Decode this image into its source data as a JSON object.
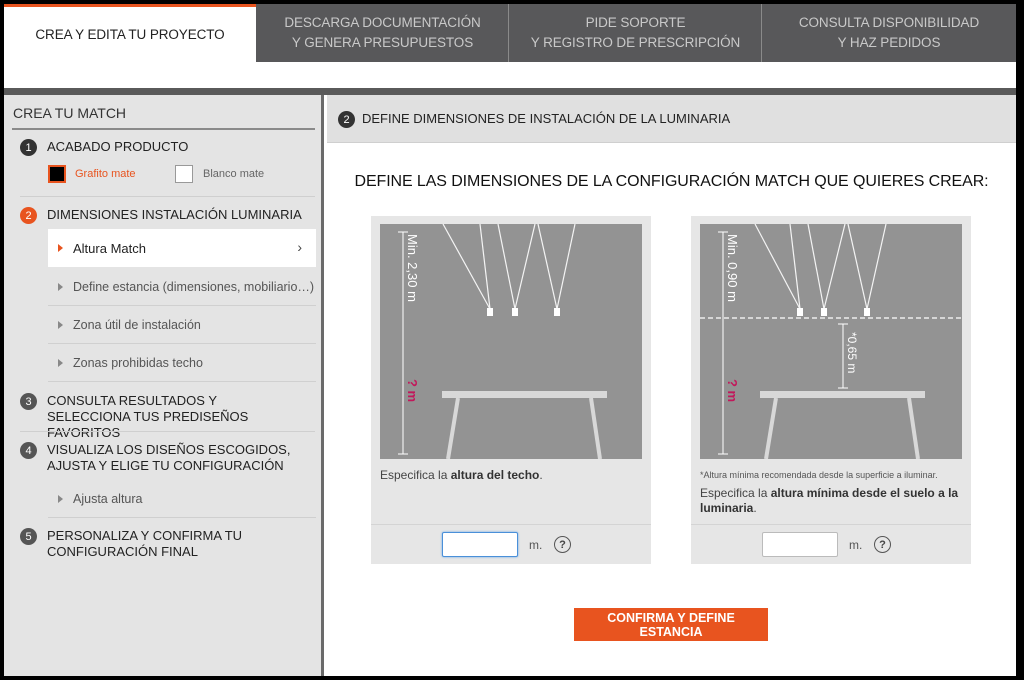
{
  "tabs": [
    {
      "line1": "CREA Y EDITA TU PROYECTO",
      "line2": ""
    },
    {
      "line1": "DESCARGA DOCUMENTACIÓN",
      "line2": "Y GENERA PRESUPUESTOS"
    },
    {
      "line1": "PIDE SOPORTE",
      "line2": "Y REGISTRO DE PRESCRIPCIÓN"
    },
    {
      "line1": "CONSULTA DISPONIBILIDAD",
      "line2": "Y HAZ PEDIDOS"
    }
  ],
  "sidebar": {
    "title": "CREA TU MATCH",
    "steps": [
      {
        "num": "1",
        "label": "ACABADO PRODUCTO"
      },
      {
        "num": "2",
        "label": "DIMENSIONES INSTALACIÓN LUMINARIA"
      },
      {
        "num": "3",
        "label": "CONSULTA RESULTADOS Y SELECCIONA TUS PREDISEÑOS FAVORITOS"
      },
      {
        "num": "4",
        "label": "VISUALIZA LOS DISEÑOS ESCOGIDOS, AJUSTA Y ELIGE TU CONFIGURACIÓN"
      },
      {
        "num": "5",
        "label": "PERSONALIZA Y CONFIRMA TU CONFIGURACIÓN FINAL"
      }
    ],
    "finishes": [
      {
        "label": "Grafito mate",
        "color": "#e8541f"
      },
      {
        "label": "Blanco mate",
        "color": "#666666"
      }
    ],
    "step2_items": [
      "Altura Match",
      "Define estancia (dimensiones, mobiliario…)",
      "Zona útil de instalación",
      "Zonas prohibidas techo"
    ],
    "step4_items": [
      "Ajusta altura"
    ]
  },
  "main": {
    "step_num": "2",
    "header": "DEFINE DIMENSIONES DE INSTALACIÓN DE LA LUMINARIA",
    "title": "DEFINE LAS DIMENSIONES DE LA CONFIGURACIÓN MATCH QUE QUIERES CREAR:",
    "card1": {
      "min_label": "Min. 2,30 m",
      "q_label": "? m",
      "caption_pre": "Especifica la ",
      "caption_bold": "altura del techo",
      "caption_post": ".",
      "input_value": "",
      "unit": "m.",
      "help": "?"
    },
    "card2": {
      "min_label": "Min. 0,90 m",
      "q_label": "? m",
      "dim_label": "*0,65 m",
      "note": "*Altura mínima recomendada desde la superficie a iluminar.",
      "caption_pre": "Especifica la ",
      "caption_bold": "altura mínima desde el suelo a la luminaria",
      "caption_post": ".",
      "input_value": "",
      "unit": "m.",
      "help": "?"
    },
    "confirm_label": "CONFIRMA Y DEFINE ESTANCIA"
  },
  "colors": {
    "accent": "#e8541f",
    "magenta": "#c2185b",
    "tabbar": "#58585a"
  }
}
